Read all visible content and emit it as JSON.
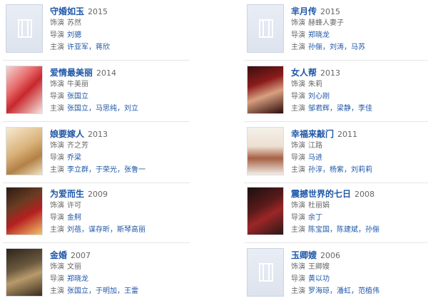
{
  "labels": {
    "role": "饰演",
    "director": "导演",
    "cast": "主演"
  },
  "movies": [
    {
      "title": "守婚如玉",
      "year": "2015",
      "role": "苏然",
      "director": "刘骢",
      "cast": "许亚军，蒋欣",
      "poster": "placeholder"
    },
    {
      "title": "芈月传",
      "year": "2015",
      "role": "赫蜂人妻子",
      "director": "郑晓龙",
      "cast": "孙俪，刘涛，马苏",
      "poster": "placeholder"
    },
    {
      "title": "爱情最美丽",
      "year": "2014",
      "role": "牛美丽",
      "director": "张国立",
      "cast": "张国立，马思纯，刘立",
      "poster": "pink"
    },
    {
      "title": "女人帮",
      "year": "2013",
      "role": "朱莉",
      "director": "刘心刚",
      "cast": "邹君辉，梁静，李佳",
      "poster": "red"
    },
    {
      "title": "娘要嫁人",
      "year": "2013",
      "role": "齐之芳",
      "director": "乔梁",
      "cast": "李立群，于荣光，张鲁一",
      "poster": "gold"
    },
    {
      "title": "幸福来敲门",
      "year": "2011",
      "role": "江路",
      "director": "马进",
      "cast": "孙淳，杨紫，刘莉莉",
      "poster": "white"
    },
    {
      "title": "为爱而生",
      "year": "2009",
      "role": "许可",
      "director": "金舸",
      "cast": "刘蓓，谋存昕，斯琴高丽",
      "poster": "crimson"
    },
    {
      "title": "震撼世界的七日",
      "year": "2008",
      "role": "杜丽娟",
      "director": "余丁",
      "cast": "陈宝国，陈建斌，孙俪",
      "poster": "dark"
    },
    {
      "title": "金婚",
      "year": "2007",
      "role": "文丽",
      "director": "郑晓龙",
      "cast": "张国立，于明加，王雷",
      "poster": "sepia"
    },
    {
      "title": "玉卿嫂",
      "year": "2006",
      "role": "王卿嫂",
      "director": "黄以功",
      "cast": "罗海琼，潘虹，范植伟",
      "poster": "placeholder"
    }
  ],
  "colors": {
    "link": "#1f57a8",
    "meta": "#666666",
    "separator": "#e6e6e6"
  }
}
